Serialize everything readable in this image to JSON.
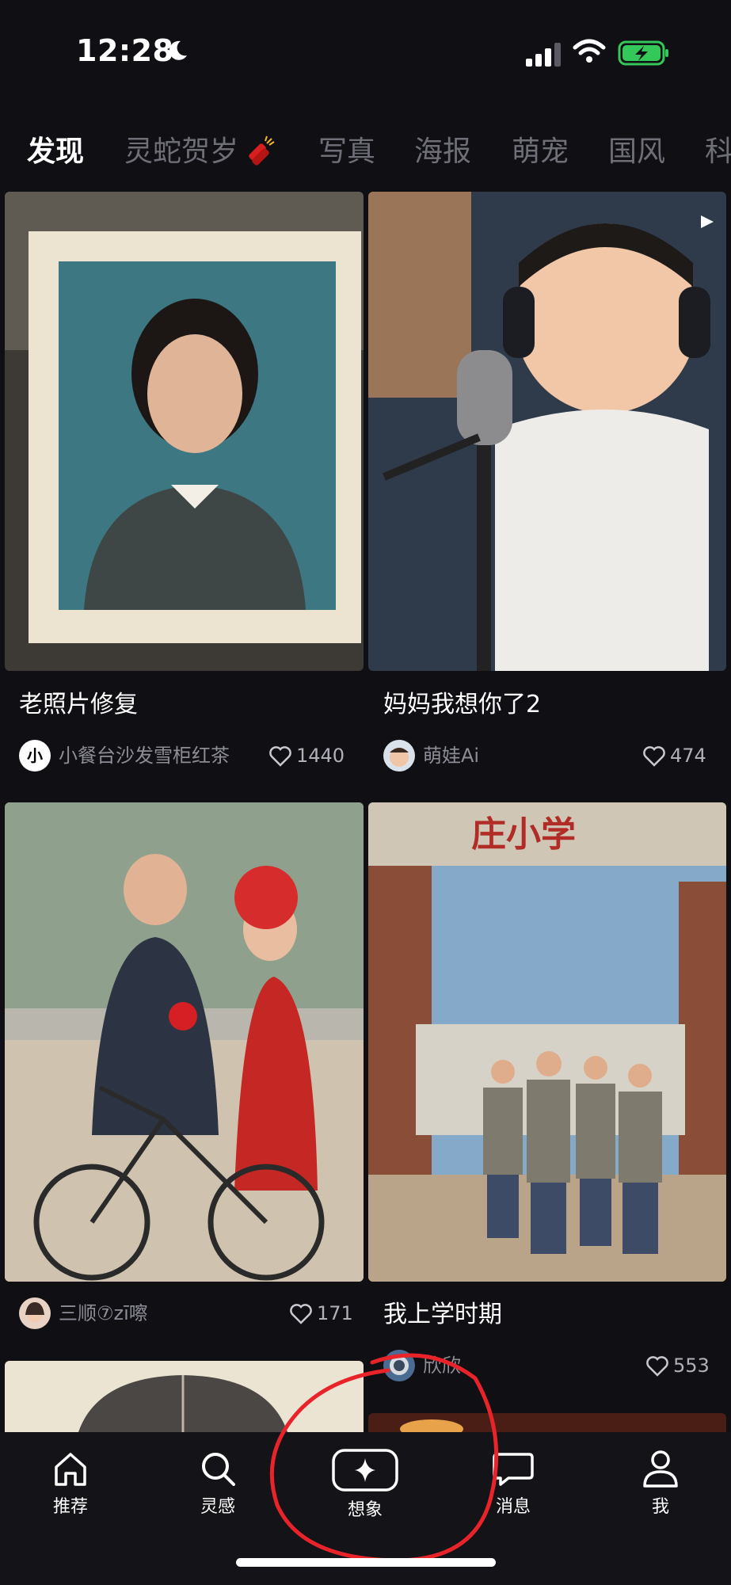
{
  "status_bar": {
    "time": "12:28"
  },
  "tabs": [
    {
      "label": "发现",
      "active": true
    },
    {
      "label": "灵蛇贺岁",
      "active": false
    },
    {
      "label": "写真",
      "active": false
    },
    {
      "label": "海报",
      "active": false
    },
    {
      "label": "萌宠",
      "active": false
    },
    {
      "label": "国风",
      "active": false
    },
    {
      "label": "科",
      "active": false
    }
  ],
  "cards": [
    {
      "title": "老照片修复",
      "author": "小餐台沙发雪柜红茶",
      "likes": "1440",
      "avatar_text": "小"
    },
    {
      "title": "妈妈我想你了2",
      "author": "萌娃Ai",
      "likes": "474"
    },
    {
      "title": "",
      "author": "三顺⑦zī嚓",
      "likes": "171"
    },
    {
      "title": "我上学时期",
      "author": "欣欣",
      "likes": "553",
      "image_text": "庄小学"
    }
  ],
  "bottom_nav": [
    {
      "label": "推荐",
      "icon": "home-icon"
    },
    {
      "label": "灵感",
      "icon": "search-icon"
    },
    {
      "label": "想象",
      "icon": "sparkle-icon"
    },
    {
      "label": "消息",
      "icon": "message-icon"
    },
    {
      "label": "我",
      "icon": "profile-icon"
    }
  ],
  "colors": {
    "background": "#0f0f14",
    "annotation_circle": "#e8242a",
    "battery_fill": "#34c759"
  }
}
